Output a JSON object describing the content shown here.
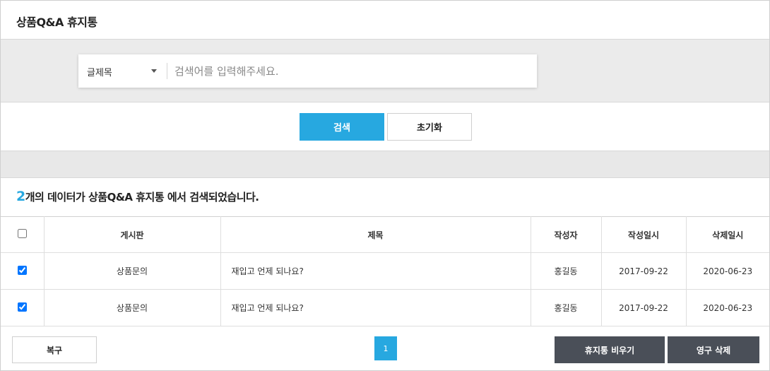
{
  "page": {
    "title": "상품Q&A 휴지통"
  },
  "search": {
    "field_selected": "글제목",
    "placeholder": "검색어를 입력해주세요.",
    "search_label": "검색",
    "reset_label": "초기화"
  },
  "result": {
    "count": "2",
    "text": "개의 데이터가 상품Q&A 휴지통 에서 검색되었습니다."
  },
  "table": {
    "columns": [
      "게시판",
      "제목",
      "작성자",
      "작성일시",
      "삭제일시"
    ],
    "rows": [
      {
        "board": "상품문의",
        "title": "재입고 언제 되나요?",
        "author": "홍길동",
        "created": "2017-09-22",
        "deleted": "2020-06-23",
        "checked": true
      },
      {
        "board": "상품문의",
        "title": "재입고 언제 되나요?",
        "author": "홍길동",
        "created": "2017-09-22",
        "deleted": "2020-06-23",
        "checked": true
      }
    ]
  },
  "footer": {
    "restore_label": "복구",
    "page": "1",
    "empty_label": "휴지통 비우기",
    "delete_label": "영구 삭제"
  },
  "colors": {
    "accent": "#27a8e0",
    "dark_button": "#4a4f58"
  }
}
